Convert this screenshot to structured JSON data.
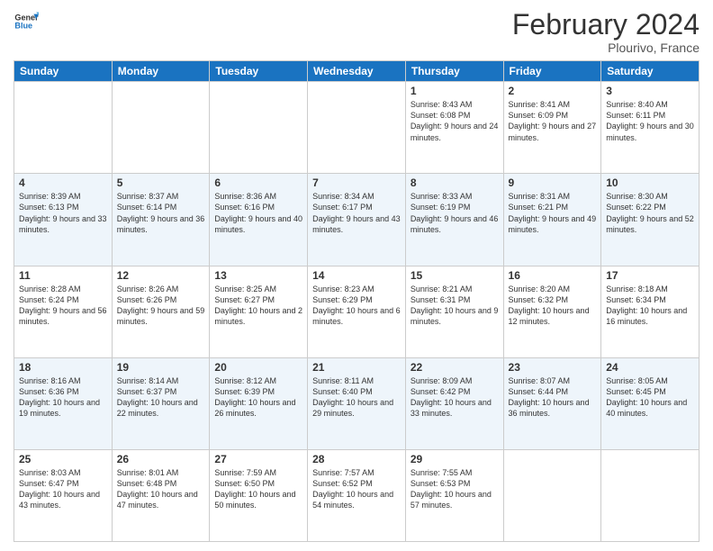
{
  "header": {
    "logo_line1": "General",
    "logo_line2": "Blue",
    "month_year": "February 2024",
    "location": "Plourivo, France"
  },
  "days_of_week": [
    "Sunday",
    "Monday",
    "Tuesday",
    "Wednesday",
    "Thursday",
    "Friday",
    "Saturday"
  ],
  "weeks": [
    [
      {
        "day": "",
        "text": ""
      },
      {
        "day": "",
        "text": ""
      },
      {
        "day": "",
        "text": ""
      },
      {
        "day": "",
        "text": ""
      },
      {
        "day": "1",
        "text": "Sunrise: 8:43 AM\nSunset: 6:08 PM\nDaylight: 9 hours and 24 minutes."
      },
      {
        "day": "2",
        "text": "Sunrise: 8:41 AM\nSunset: 6:09 PM\nDaylight: 9 hours and 27 minutes."
      },
      {
        "day": "3",
        "text": "Sunrise: 8:40 AM\nSunset: 6:11 PM\nDaylight: 9 hours and 30 minutes."
      }
    ],
    [
      {
        "day": "4",
        "text": "Sunrise: 8:39 AM\nSunset: 6:13 PM\nDaylight: 9 hours and 33 minutes."
      },
      {
        "day": "5",
        "text": "Sunrise: 8:37 AM\nSunset: 6:14 PM\nDaylight: 9 hours and 36 minutes."
      },
      {
        "day": "6",
        "text": "Sunrise: 8:36 AM\nSunset: 6:16 PM\nDaylight: 9 hours and 40 minutes."
      },
      {
        "day": "7",
        "text": "Sunrise: 8:34 AM\nSunset: 6:17 PM\nDaylight: 9 hours and 43 minutes."
      },
      {
        "day": "8",
        "text": "Sunrise: 8:33 AM\nSunset: 6:19 PM\nDaylight: 9 hours and 46 minutes."
      },
      {
        "day": "9",
        "text": "Sunrise: 8:31 AM\nSunset: 6:21 PM\nDaylight: 9 hours and 49 minutes."
      },
      {
        "day": "10",
        "text": "Sunrise: 8:30 AM\nSunset: 6:22 PM\nDaylight: 9 hours and 52 minutes."
      }
    ],
    [
      {
        "day": "11",
        "text": "Sunrise: 8:28 AM\nSunset: 6:24 PM\nDaylight: 9 hours and 56 minutes."
      },
      {
        "day": "12",
        "text": "Sunrise: 8:26 AM\nSunset: 6:26 PM\nDaylight: 9 hours and 59 minutes."
      },
      {
        "day": "13",
        "text": "Sunrise: 8:25 AM\nSunset: 6:27 PM\nDaylight: 10 hours and 2 minutes."
      },
      {
        "day": "14",
        "text": "Sunrise: 8:23 AM\nSunset: 6:29 PM\nDaylight: 10 hours and 6 minutes."
      },
      {
        "day": "15",
        "text": "Sunrise: 8:21 AM\nSunset: 6:31 PM\nDaylight: 10 hours and 9 minutes."
      },
      {
        "day": "16",
        "text": "Sunrise: 8:20 AM\nSunset: 6:32 PM\nDaylight: 10 hours and 12 minutes."
      },
      {
        "day": "17",
        "text": "Sunrise: 8:18 AM\nSunset: 6:34 PM\nDaylight: 10 hours and 16 minutes."
      }
    ],
    [
      {
        "day": "18",
        "text": "Sunrise: 8:16 AM\nSunset: 6:36 PM\nDaylight: 10 hours and 19 minutes."
      },
      {
        "day": "19",
        "text": "Sunrise: 8:14 AM\nSunset: 6:37 PM\nDaylight: 10 hours and 22 minutes."
      },
      {
        "day": "20",
        "text": "Sunrise: 8:12 AM\nSunset: 6:39 PM\nDaylight: 10 hours and 26 minutes."
      },
      {
        "day": "21",
        "text": "Sunrise: 8:11 AM\nSunset: 6:40 PM\nDaylight: 10 hours and 29 minutes."
      },
      {
        "day": "22",
        "text": "Sunrise: 8:09 AM\nSunset: 6:42 PM\nDaylight: 10 hours and 33 minutes."
      },
      {
        "day": "23",
        "text": "Sunrise: 8:07 AM\nSunset: 6:44 PM\nDaylight: 10 hours and 36 minutes."
      },
      {
        "day": "24",
        "text": "Sunrise: 8:05 AM\nSunset: 6:45 PM\nDaylight: 10 hours and 40 minutes."
      }
    ],
    [
      {
        "day": "25",
        "text": "Sunrise: 8:03 AM\nSunset: 6:47 PM\nDaylight: 10 hours and 43 minutes."
      },
      {
        "day": "26",
        "text": "Sunrise: 8:01 AM\nSunset: 6:48 PM\nDaylight: 10 hours and 47 minutes."
      },
      {
        "day": "27",
        "text": "Sunrise: 7:59 AM\nSunset: 6:50 PM\nDaylight: 10 hours and 50 minutes."
      },
      {
        "day": "28",
        "text": "Sunrise: 7:57 AM\nSunset: 6:52 PM\nDaylight: 10 hours and 54 minutes."
      },
      {
        "day": "29",
        "text": "Sunrise: 7:55 AM\nSunset: 6:53 PM\nDaylight: 10 hours and 57 minutes."
      },
      {
        "day": "",
        "text": ""
      },
      {
        "day": "",
        "text": ""
      }
    ]
  ]
}
